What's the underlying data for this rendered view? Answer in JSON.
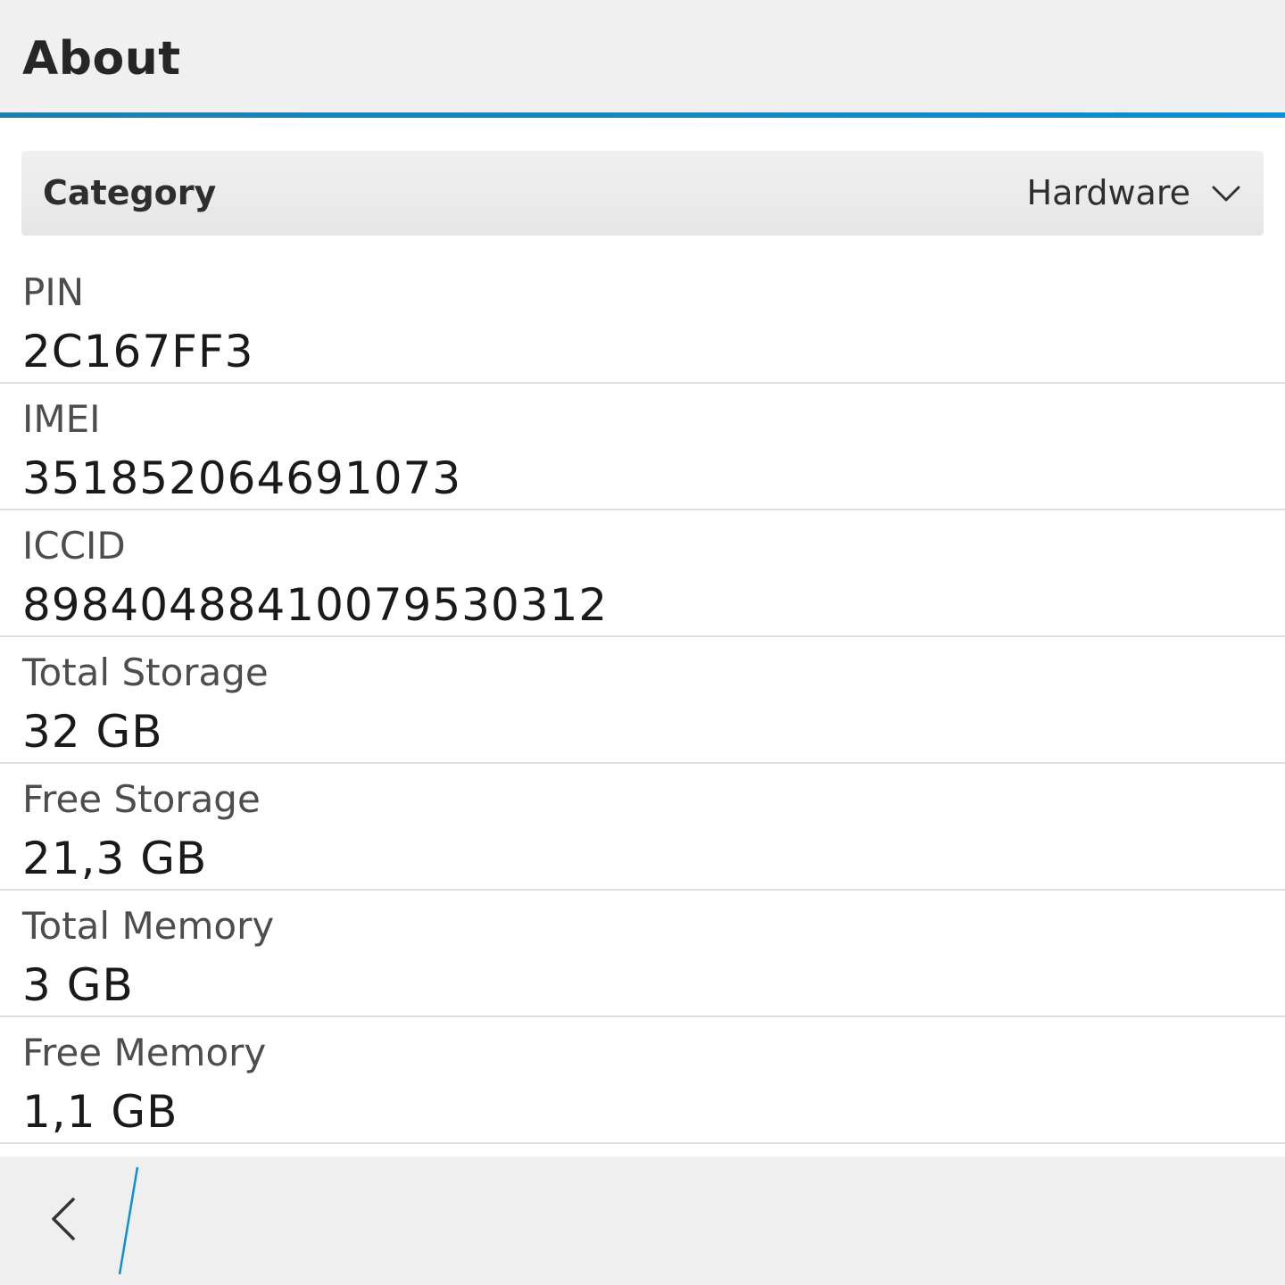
{
  "header": {
    "title": "About"
  },
  "category": {
    "label": "Category",
    "selected": "Hardware"
  },
  "items": [
    {
      "label": "PIN",
      "value": "2C167FF3"
    },
    {
      "label": "IMEI",
      "value": "351852064691073"
    },
    {
      "label": "ICCID",
      "value": "89840488410079530312"
    },
    {
      "label": "Total Storage",
      "value": "32 GB"
    },
    {
      "label": "Free Storage",
      "value": "21,3 GB"
    },
    {
      "label": "Total Memory",
      "value": "3 GB"
    },
    {
      "label": "Free Memory",
      "value": "1,1 GB"
    }
  ],
  "icons": {
    "back": "back-arrow-icon",
    "dropdown": "chevron-down-icon"
  },
  "colors": {
    "accent": "#0c8fd3",
    "bar_background": "#f0f0f0",
    "divider": "#e0e0e0"
  }
}
